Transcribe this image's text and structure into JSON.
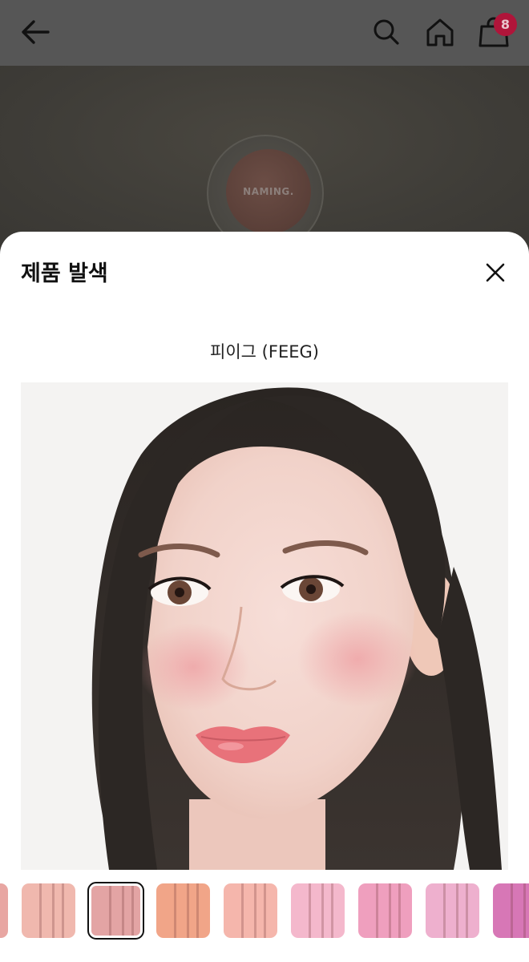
{
  "header": {
    "back_icon": "arrow-left-icon",
    "search_icon": "search-icon",
    "home_icon": "home-icon",
    "cart_icon": "shopping-bag-icon",
    "cart_count": "8"
  },
  "hero": {
    "brand_label": "NAMING."
  },
  "sheet": {
    "title": "제품 발색",
    "close_icon": "close-icon",
    "shade_name": "피이그 (FEEG)"
  },
  "swatches": [
    {
      "color": "#e8a6a2",
      "selected": false
    },
    {
      "color": "#f0b8ae",
      "selected": false
    },
    {
      "color": "#e3a4a4",
      "selected": true
    },
    {
      "color": "#f1a588",
      "selected": false
    },
    {
      "color": "#f5b6ac",
      "selected": false
    },
    {
      "color": "#f4b8cc",
      "selected": false
    },
    {
      "color": "#ef9fbe",
      "selected": false
    },
    {
      "color": "#eeb0ce",
      "selected": false
    },
    {
      "color": "#d777b6",
      "selected": false
    }
  ],
  "colors": {
    "badge": "#b0153a",
    "overlay_header": "#565656"
  }
}
